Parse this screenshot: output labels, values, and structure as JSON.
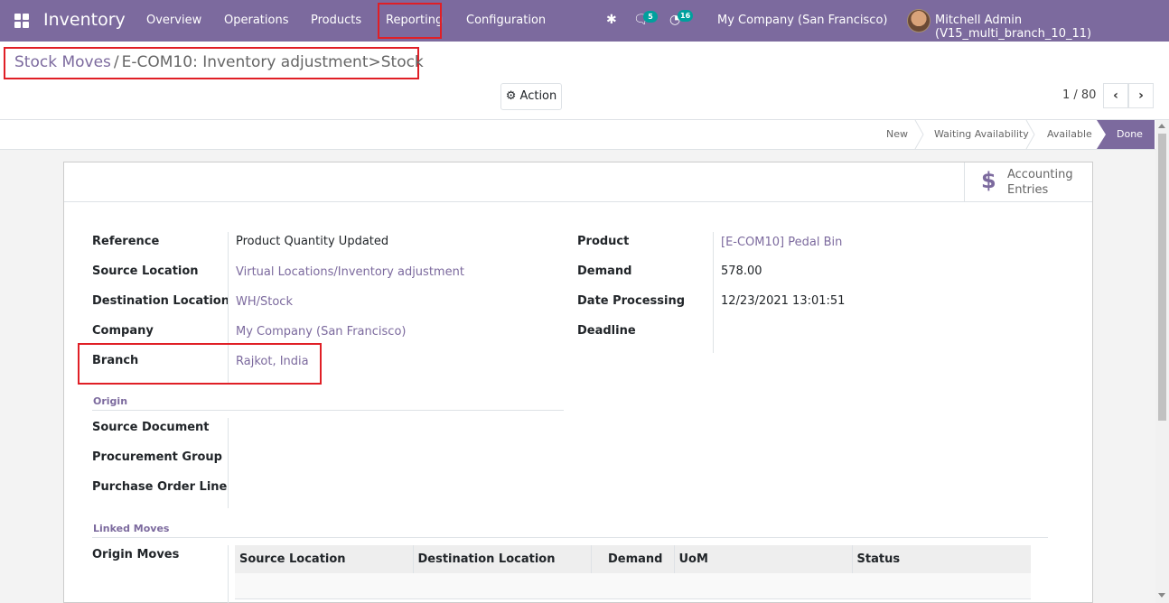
{
  "navbar": {
    "app_name": "Inventory",
    "menu": [
      "Overview",
      "Operations",
      "Products",
      "Reporting",
      "Configuration"
    ],
    "messages_count": "5",
    "activities_count": "16",
    "company": "My Company (San Francisco)",
    "user": "Mitchell Admin (V15_multi_branch_10_11)"
  },
  "breadcrumb": {
    "parent": "Stock Moves",
    "separator": "/",
    "current": "E-COM10: Inventory adjustment>Stock"
  },
  "toolbar": {
    "action_label": "Action",
    "pager_value": "1 / 80",
    "prev_icon": "chevron-left-icon",
    "next_icon": "chevron-right-icon"
  },
  "statusbar": {
    "stages": [
      "New",
      "Waiting Availability",
      "Available",
      "Done"
    ],
    "current_stage": "Done"
  },
  "stat_button": {
    "icon": "dollar-icon",
    "line1": "Accounting",
    "line2": "Entries"
  },
  "form": {
    "left": [
      {
        "label": "Reference",
        "value": "Product Quantity Updated"
      },
      {
        "label": "Source Location",
        "value": "Virtual Locations/Inventory adjustment"
      },
      {
        "label": "Destination Location",
        "value": "WH/Stock"
      },
      {
        "label": "Company",
        "value": "My Company (San Francisco)"
      },
      {
        "label": "Branch",
        "value": "Rajkot, India"
      }
    ],
    "right": [
      {
        "label": "Product",
        "value": "[E-COM10] Pedal Bin"
      },
      {
        "label": "Demand",
        "value": "578.00"
      },
      {
        "label": "Date Processing",
        "value": "12/23/2021 13:01:51"
      },
      {
        "label": "Deadline",
        "value": ""
      }
    ],
    "origin_title": "Origin",
    "origin": [
      {
        "label": "Source Document"
      },
      {
        "label": "Procurement Group"
      },
      {
        "label": "Purchase Order Line"
      }
    ],
    "linked_title": "Linked Moves",
    "origin_moves_label": "Origin Moves",
    "table_headers": [
      "Source Location",
      "Destination Location",
      "Demand",
      "UoM",
      "Status"
    ]
  },
  "colors": {
    "primary": "#7c6a9e",
    "annotation": "#e01f26",
    "badge": "#00a09d"
  }
}
